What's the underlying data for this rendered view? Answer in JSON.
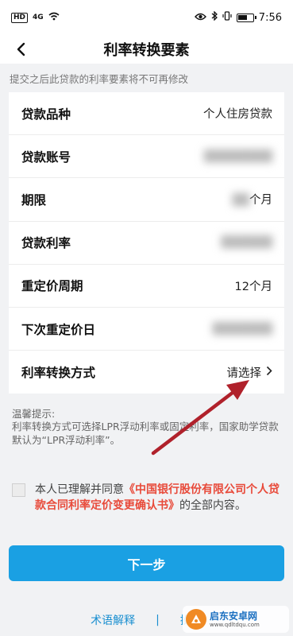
{
  "status_bar": {
    "hd_badge": "HD",
    "signal": "4G",
    "time": "7:56",
    "icons": [
      "wifi-icon",
      "eye-icon",
      "bluetooth-icon",
      "vibrate-icon",
      "battery-icon"
    ]
  },
  "nav": {
    "title": "利率转换要素",
    "back_icon": "chevron-left-icon"
  },
  "notice": "提交之后此贷款的利率要素将不可再修改",
  "form": {
    "rows": [
      {
        "label": "贷款品种",
        "value": "个人住房贷款",
        "blurred": false
      },
      {
        "label": "贷款账号",
        "value": "",
        "blurred": true
      },
      {
        "label": "期限",
        "value": "个月",
        "blurred": true
      },
      {
        "label": "贷款利率",
        "value": "",
        "blurred": true
      },
      {
        "label": "重定价周期",
        "value": "12个月",
        "blurred": false
      },
      {
        "label": "下次重定价日",
        "value": "",
        "blurred": true
      }
    ],
    "select_row": {
      "label": "利率转换方式",
      "value": "请选择"
    }
  },
  "tip": {
    "title": "温馨提示:",
    "body": "利率转换方式可选择LPR浮动利率或固定利率，国家助学贷款默认为“LPR浮动利率”。"
  },
  "agreement": {
    "prefix": "本人已理解并同意",
    "link": "《中国银行股份有限公司个人贷款合同利率定价变更确认书》",
    "suffix": "的全部内容。"
  },
  "next_button": "下一步",
  "bottom_links": {
    "terms": "术语解释",
    "separator": "|",
    "guide": "操作"
  },
  "watermark": {
    "name": "启东安卓网",
    "url": "www.qdltdqu.com"
  },
  "colors": {
    "accent": "#1aa0e3",
    "link_red": "#e84a3a",
    "annotation_arrow": "#b0212b"
  }
}
